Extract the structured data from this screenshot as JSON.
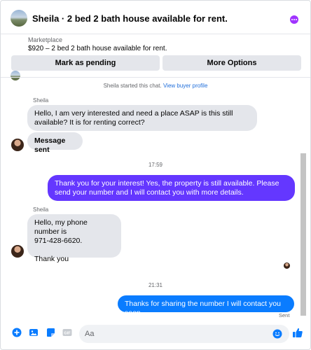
{
  "header": {
    "title": "Sheila · 2 bed 2 bath house available for rent."
  },
  "listing": {
    "source": "Marketplace",
    "price_title": "$920 – 2 bed 2 bath house available for rent."
  },
  "actions": {
    "mark_pending": "Mark as pending",
    "more_options": "More Options"
  },
  "system": {
    "started_text": "Sheila started this chat.",
    "view_profile": "View buyer profile"
  },
  "messages": {
    "sender_name": "Sheila",
    "m1": "Hello, I am very interested and need a place ASAP is this still available? It is for renting correct?",
    "m2": "Message sent",
    "time1": "17:59",
    "m3": "Thank you for your interest! Yes, the property is still available. Please send your number and I will contact you with more details.",
    "m4_line1": "Hello, my phone number is",
    "m4_line2": "971-428-6620.",
    "m4_line3": "Thank you",
    "time2": "21:31",
    "m5": "Thanks for sharing the number I will contact you soon.",
    "status": "Sent"
  },
  "composer": {
    "placeholder": "Aa"
  },
  "colors": {
    "accent": "#0a7cff",
    "outgoing_purple": "#6437ff",
    "incoming": "#e4e6eb"
  },
  "icons": [
    "plus-icon",
    "image-icon",
    "sticker-icon",
    "gif-icon",
    "emoji-icon",
    "thumbs-up-icon",
    "more-options-icon"
  ]
}
